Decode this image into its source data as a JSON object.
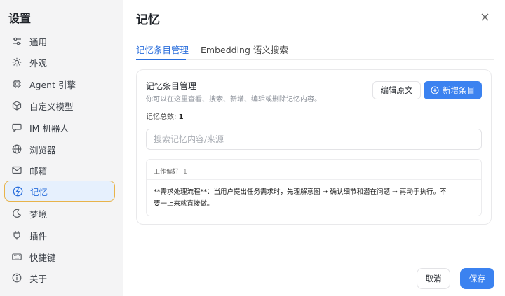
{
  "sidebar": {
    "title": "设置",
    "items": [
      {
        "label": "通用",
        "icon": "sliders-icon"
      },
      {
        "label": "外观",
        "icon": "sun-icon"
      },
      {
        "label": "Agent 引擎",
        "icon": "chip-icon"
      },
      {
        "label": "自定义模型",
        "icon": "cube-icon"
      },
      {
        "label": "IM 机器人",
        "icon": "chat-bubble-icon"
      },
      {
        "label": "浏览器",
        "icon": "globe-icon"
      },
      {
        "label": "邮箱",
        "icon": "mail-icon"
      },
      {
        "label": "记忆",
        "icon": "brain-icon",
        "active": true
      },
      {
        "label": "梦境",
        "icon": "moon-icon"
      },
      {
        "label": "插件",
        "icon": "plug-icon"
      },
      {
        "label": "快捷键",
        "icon": "keyboard-icon"
      },
      {
        "label": "关于",
        "icon": "info-icon"
      }
    ]
  },
  "main": {
    "title": "记忆",
    "tabs": [
      {
        "label": "记忆条目管理",
        "active": true
      },
      {
        "label": "Embedding 语义搜索",
        "active": false
      }
    ],
    "card": {
      "title": "记忆条目管理",
      "description": "你可以在这里查看、搜索、新增、编辑或删除记忆内容。",
      "edit_label": "编辑原文",
      "add_label": "新增条目",
      "count_label": "记忆总数:",
      "count_value": "1",
      "search_placeholder": "搜索记忆内容/来源",
      "entry": {
        "category": "工作偏好",
        "count": "1",
        "text": "**需求处理流程**：当用户提出任务需求时，先理解意图 ➞ 确认细节和潜在问题 ➞ 再动手执行。不要一上来就直接做。"
      }
    }
  },
  "footer": {
    "cancel_label": "取消",
    "save_label": "保存"
  },
  "colors": {
    "accent": "#3b82f0",
    "active_border": "#e8b34a",
    "sidebar_bg": "#f4f4f5"
  }
}
